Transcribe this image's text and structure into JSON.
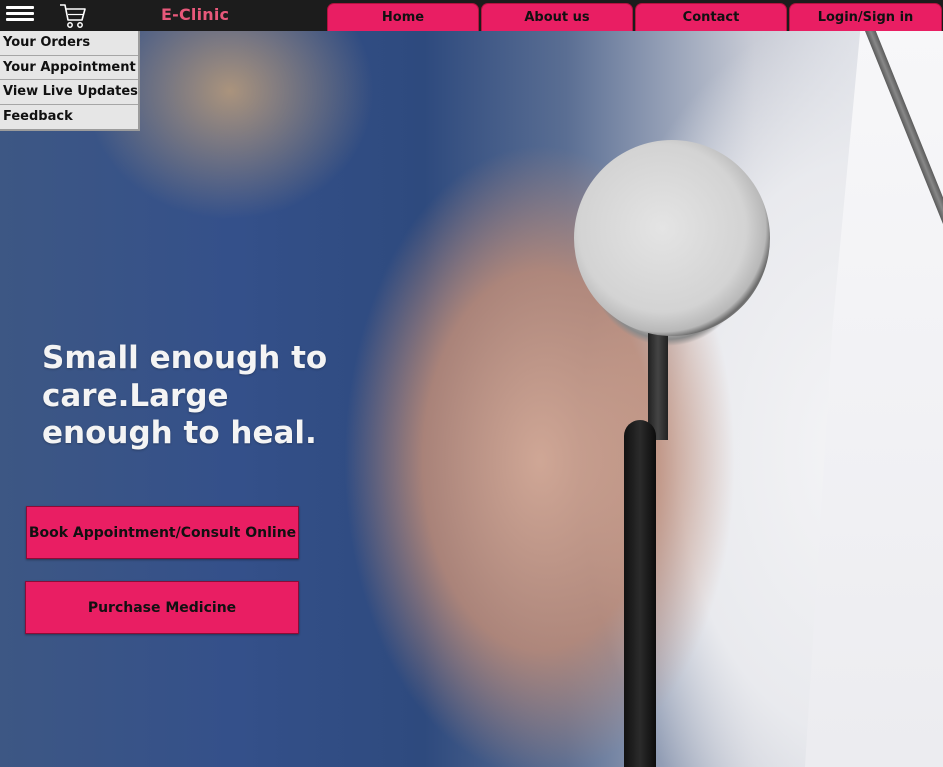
{
  "header": {
    "brand": "E-Clinic",
    "menu_icon": "hamburger-menu-icon",
    "cart_icon": "shopping-cart-icon",
    "nav": [
      {
        "label": "Home"
      },
      {
        "label": "About us"
      },
      {
        "label": "Contact"
      },
      {
        "label": "Login/Sign in"
      }
    ]
  },
  "dropdown": {
    "items": [
      {
        "label": "Your Orders"
      },
      {
        "label": "Your Appointment"
      },
      {
        "label": "View Live Updates"
      },
      {
        "label": "Feedback"
      }
    ]
  },
  "hero": {
    "headline": "Small enough to care.Large enough to heal.",
    "book_button": "Book Appointment/Consult Online",
    "medicine_button": "Purchase Medicine"
  },
  "colors": {
    "accent": "#e91e63",
    "brand_text": "#e7587a",
    "topbar": "#1c1c1c",
    "menu_bg": "#e6e6e6"
  }
}
